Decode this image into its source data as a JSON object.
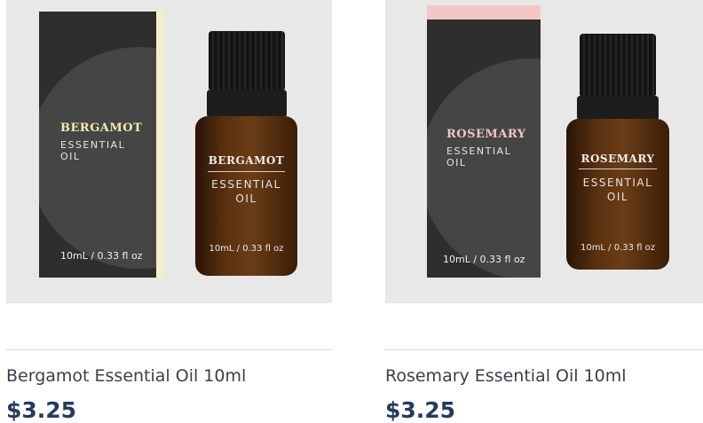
{
  "products": [
    {
      "title": "Bergamot Essential Oil 10ml",
      "price": "$3.25",
      "accent": "#f3f1c4",
      "name_color": "#f2e9b0",
      "image": {
        "box_name": "BERGAMOT",
        "box_sub": "ESSENTIAL\nOIL",
        "box_volume": "10mL / 0.33 fl oz",
        "bottle_name": "BERGAMOT",
        "bottle_sub": "ESSENTIAL\nOIL",
        "bottle_volume": "10mL / 0.33 fl oz"
      }
    },
    {
      "title": "Rosemary Essential Oil 10ml",
      "price": "$3.25",
      "accent": "#f4c7c7",
      "name_color": "#f4c4c4",
      "image": {
        "box_name": "ROSEMARY",
        "box_sub": "ESSENTIAL\nOIL",
        "box_volume": "10mL / 0.33 fl oz",
        "bottle_name": "ROSEMARY",
        "bottle_sub": "ESSENTIAL\nOIL",
        "bottle_volume": "10mL / 0.33 fl oz"
      }
    }
  ]
}
